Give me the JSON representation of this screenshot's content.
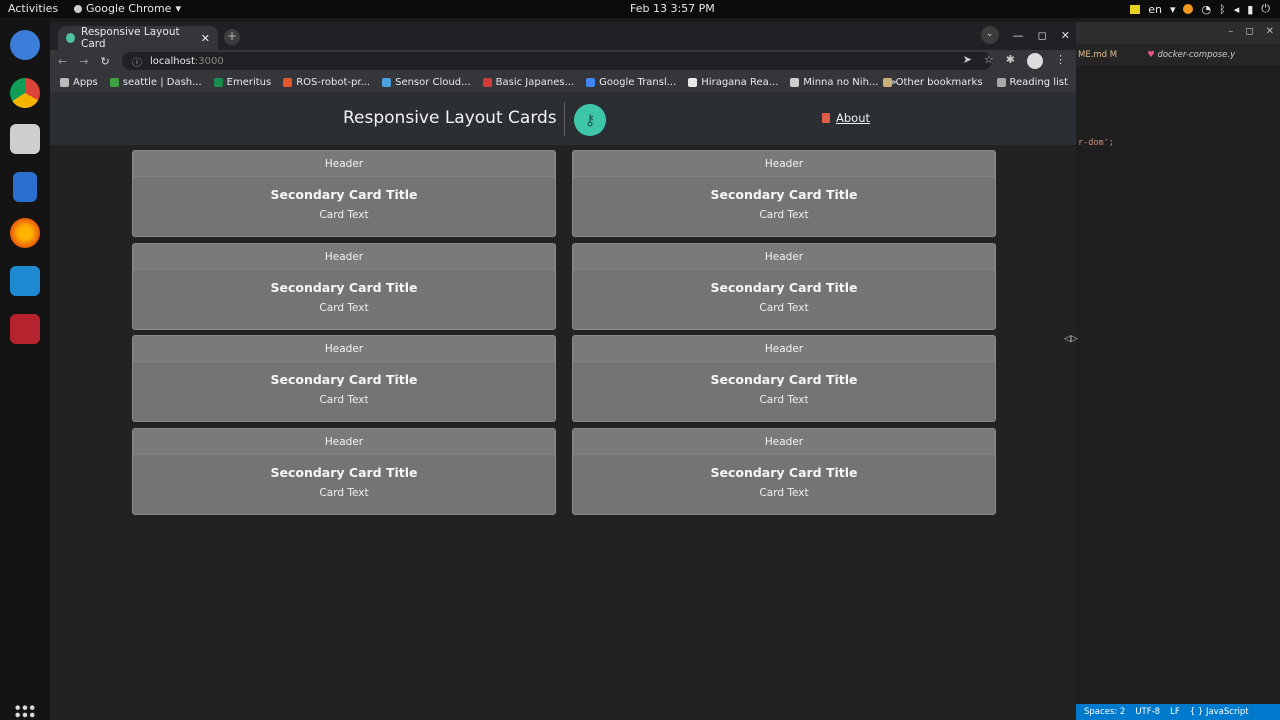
{
  "topbar": {
    "activities": "Activities",
    "app_name": "Google Chrome",
    "clock": "Feb 13  3:57 PM",
    "lang": "en"
  },
  "browser": {
    "tab_title": "Responsive Layout Card",
    "url_host": "localhost",
    "url_port": ":3000",
    "bookmarks": [
      {
        "label": "Apps",
        "color": "#bbbbbb"
      },
      {
        "label": "seattle | Dash...",
        "color": "#3fa142"
      },
      {
        "label": "Emeritus",
        "color": "#1a8c4e"
      },
      {
        "label": "ROS-robot-pr...",
        "color": "#e4572e"
      },
      {
        "label": "Sensor Cloud...",
        "color": "#4aa3df"
      },
      {
        "label": "Basic Japanes...",
        "color": "#d13b3b"
      },
      {
        "label": "Google Transl...",
        "color": "#4285f4"
      },
      {
        "label": "Hiragana Rea...",
        "color": "#e8e8e8"
      },
      {
        "label": "Minna no Nih...",
        "color": "#cccccc"
      }
    ],
    "bookmarks_more": "»",
    "other_bookmarks": "Other bookmarks",
    "reading_list": "Reading list"
  },
  "navbar": {
    "brand": "Responsive Layout Cards",
    "about": "About"
  },
  "cards": [
    {
      "header": "Header",
      "title": "Secondary Card Title",
      "text": "Card Text"
    },
    {
      "header": "Header",
      "title": "Secondary Card Title",
      "text": "Card Text"
    },
    {
      "header": "Header",
      "title": "Secondary Card Title",
      "text": "Card Text"
    },
    {
      "header": "Header",
      "title": "Secondary Card Title",
      "text": "Card Text"
    },
    {
      "header": "Header",
      "title": "Secondary Card Title",
      "text": "Card Text"
    },
    {
      "header": "Header",
      "title": "Secondary Card Title",
      "text": "Card Text"
    },
    {
      "header": "Header",
      "title": "Secondary Card Title",
      "text": "Card Text"
    },
    {
      "header": "Header",
      "title": "Secondary Card Title",
      "text": "Card Text"
    }
  ],
  "vscode": {
    "tab1": "ME.md M",
    "tab2": "docker-compose.y",
    "code_line": "r-dom';",
    "status": [
      "Spaces: 2",
      "UTF-8",
      "LF",
      "{ } JavaScript"
    ]
  },
  "colors": {
    "card_bg": "#747573",
    "navbar_bg": "#2b2f33",
    "logo": "#3ec6a8"
  }
}
